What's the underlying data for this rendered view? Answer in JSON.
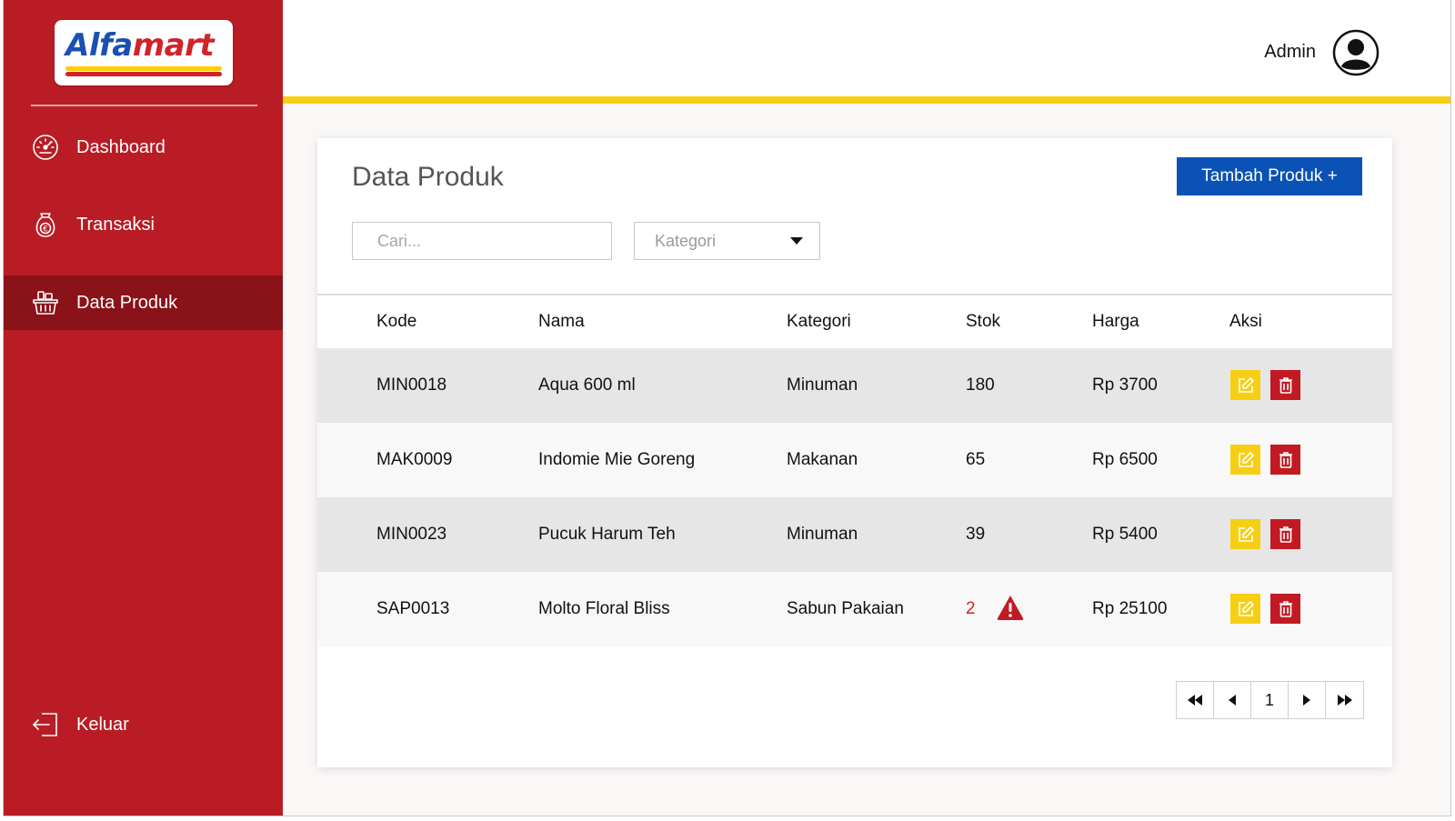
{
  "brand": {
    "logo_first": "Alfa",
    "logo_second": "mart"
  },
  "sidebar": {
    "items": [
      {
        "label": "Dashboard",
        "icon": "speedometer-icon",
        "active": false
      },
      {
        "label": "Transaksi",
        "icon": "money-bag-icon",
        "active": false
      },
      {
        "label": "Data Produk",
        "icon": "basket-icon",
        "active": true
      }
    ],
    "logout": {
      "label": "Keluar",
      "icon": "logout-icon"
    }
  },
  "header": {
    "user_name": "Admin"
  },
  "main": {
    "title": "Data Produk",
    "add_button": "Tambah Produk +",
    "search": {
      "placeholder": "Cari...",
      "value": ""
    },
    "category_select": {
      "placeholder": "Kategori"
    },
    "table": {
      "columns": [
        "Kode",
        "Nama",
        "Kategori",
        "Stok",
        "Harga",
        "Aksi"
      ],
      "rows": [
        {
          "kode": "MIN0018",
          "nama": "Aqua 600 ml",
          "kategori": "Minuman",
          "stok": "180",
          "harga": "Rp 3700",
          "low_stock": false
        },
        {
          "kode": "MAK0009",
          "nama": "Indomie Mie Goreng",
          "kategori": "Makanan",
          "stok": "65",
          "harga": "Rp 6500",
          "low_stock": false
        },
        {
          "kode": "MIN0023",
          "nama": "Pucuk Harum Teh",
          "kategori": "Minuman",
          "stok": "39",
          "harga": "Rp 5400",
          "low_stock": false
        },
        {
          "kode": "SAP0013",
          "nama": "Molto Floral Bliss",
          "kategori": "Sabun Pakaian",
          "stok": "2",
          "harga": "Rp 25100",
          "low_stock": true
        }
      ]
    },
    "pagination": {
      "current_page": "1"
    }
  },
  "colors": {
    "sidebar_bg": "#b91c24",
    "sidebar_active": "#8a1219",
    "accent_yellow": "#f6cf14",
    "primary_blue": "#0a52b5",
    "danger_red": "#c11a23"
  }
}
